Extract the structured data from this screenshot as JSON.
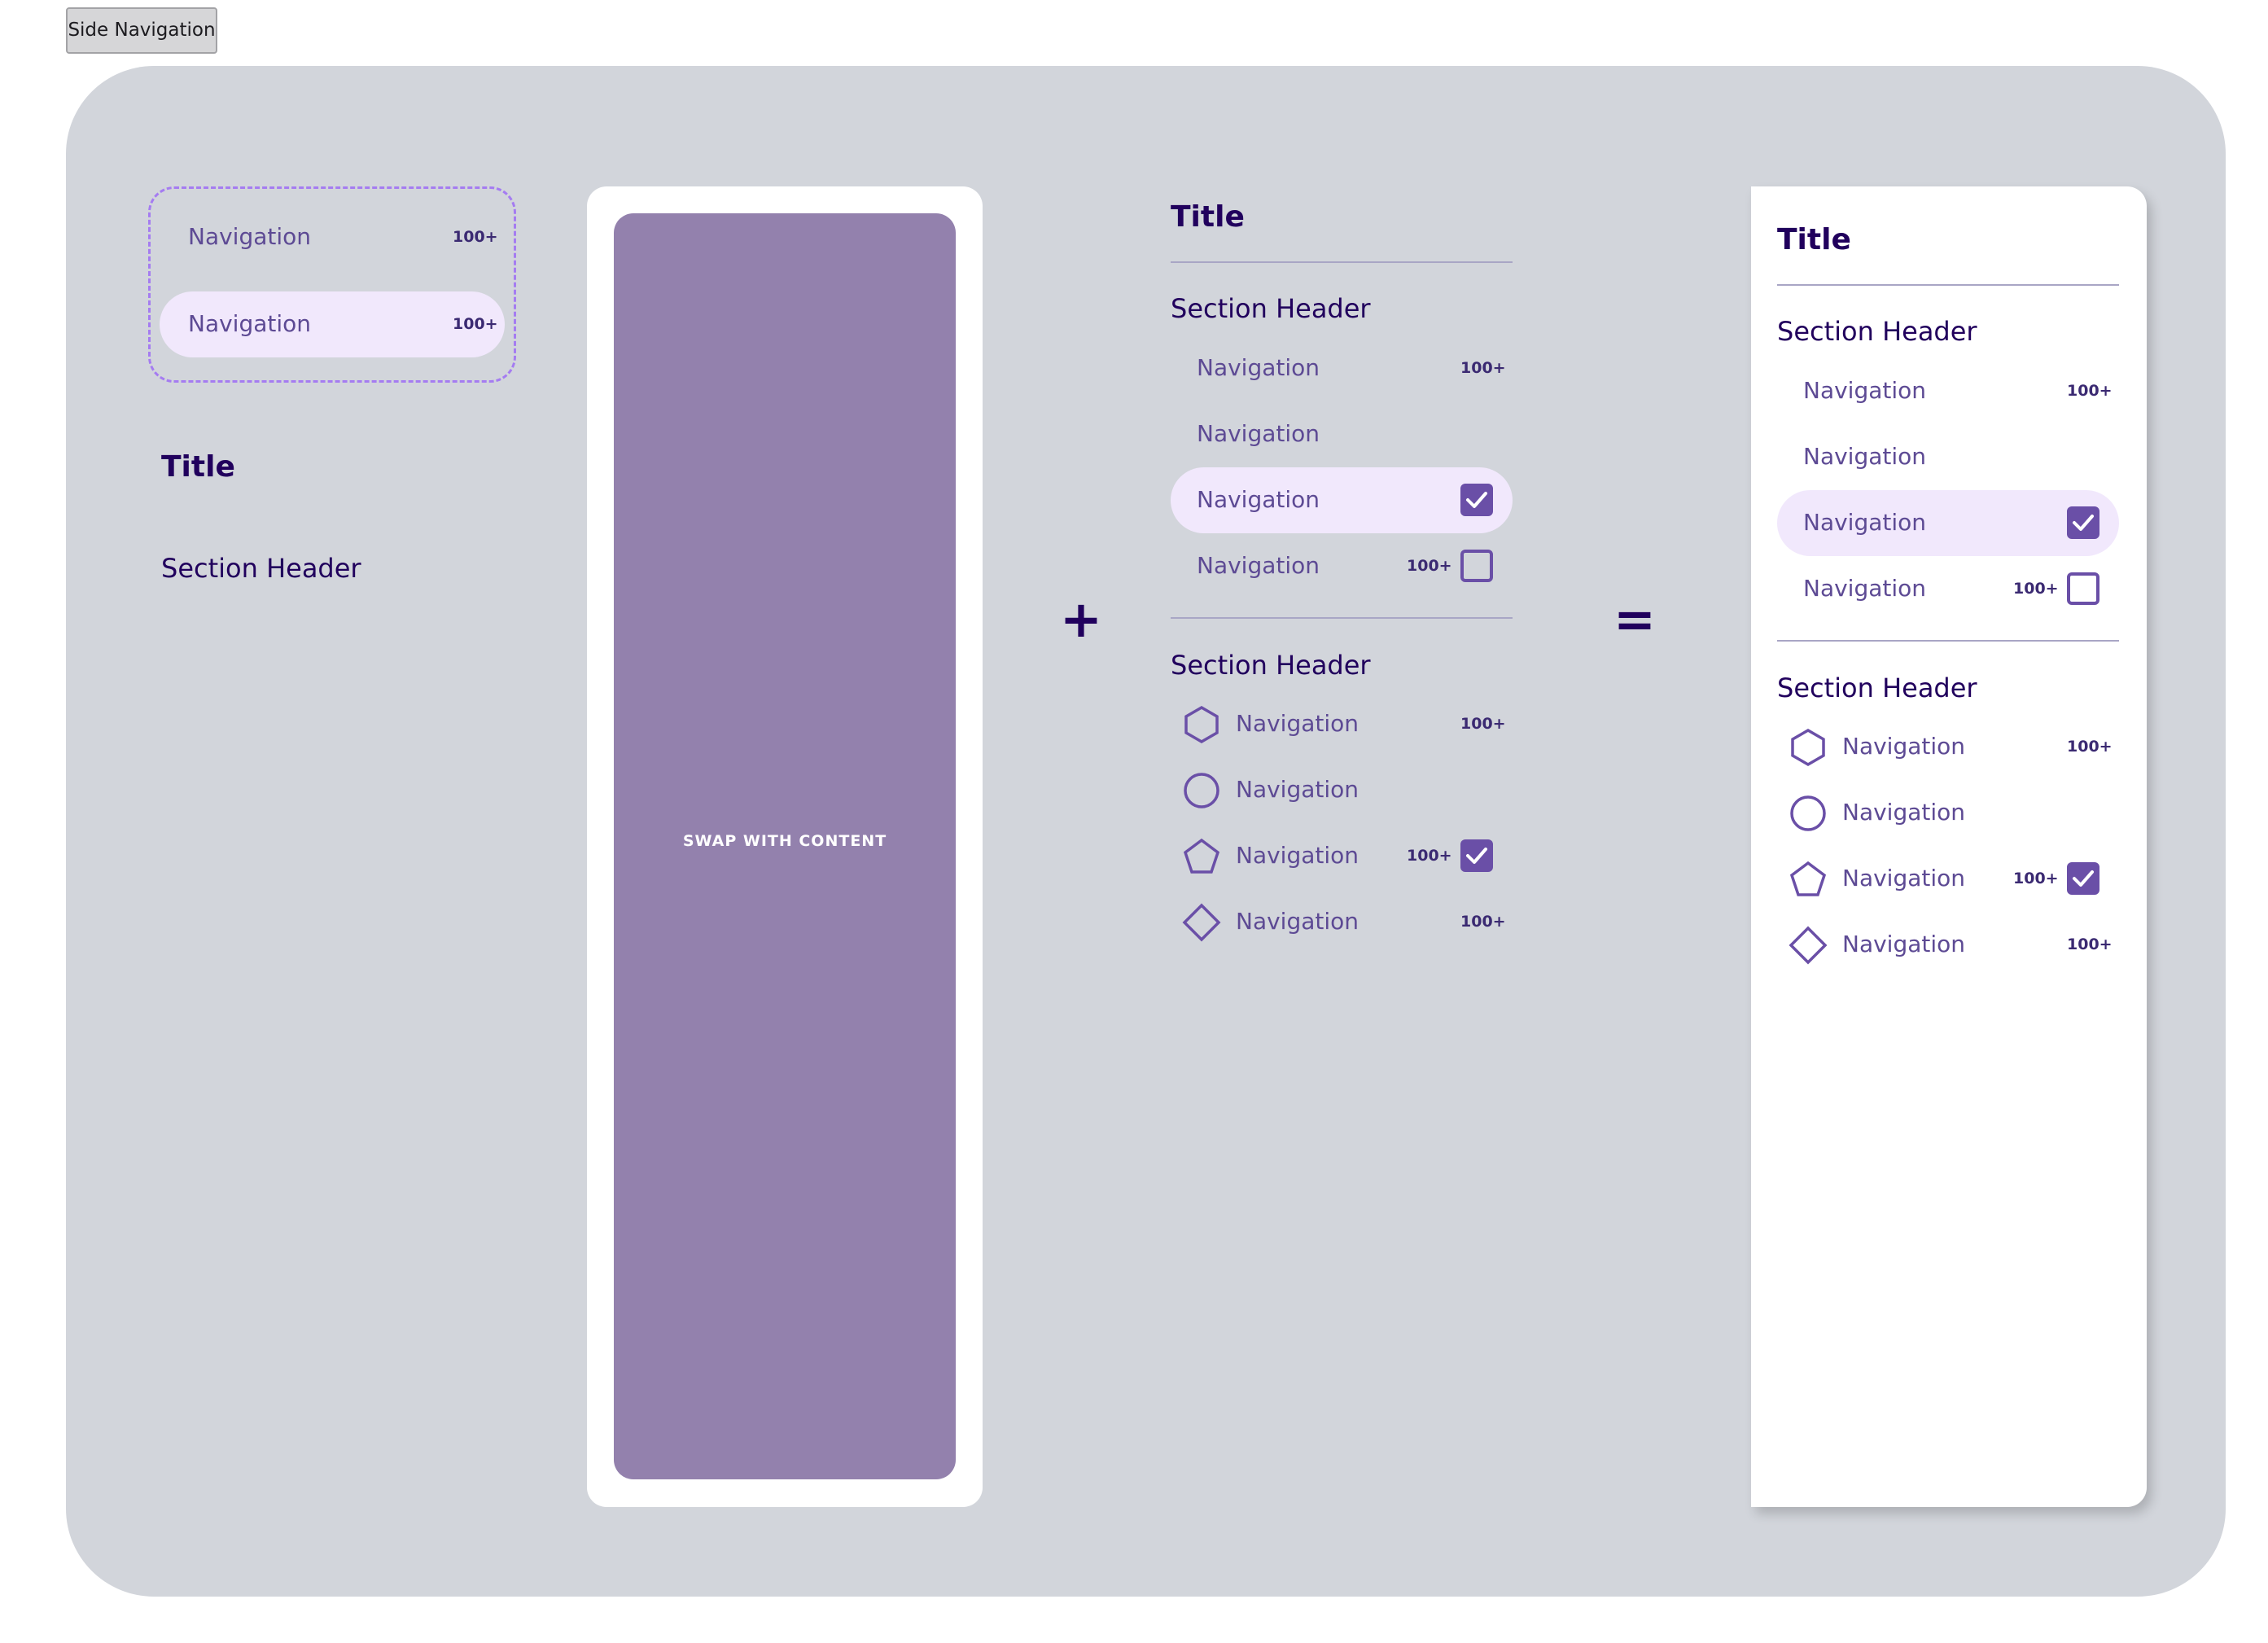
{
  "page_label": "Side Navigation",
  "nav_label": "Navigation",
  "badge": "100+",
  "title": "Title",
  "section_header": "Section Header",
  "swap_label": "SWAP WITH CONTENT",
  "plus_symbol": "+",
  "equals_symbol": "=",
  "colors": {
    "canvas": "#d2d5db",
    "active_row": "#f1e8fc",
    "accent": "#6a4fa7",
    "text_dark": "#21005d",
    "content_fill": "#9381ad"
  },
  "icons": [
    "hexagon-icon",
    "circle-icon",
    "pentagon-icon",
    "diamond-icon",
    "checkbox-checked-icon",
    "checkbox-empty-icon"
  ]
}
